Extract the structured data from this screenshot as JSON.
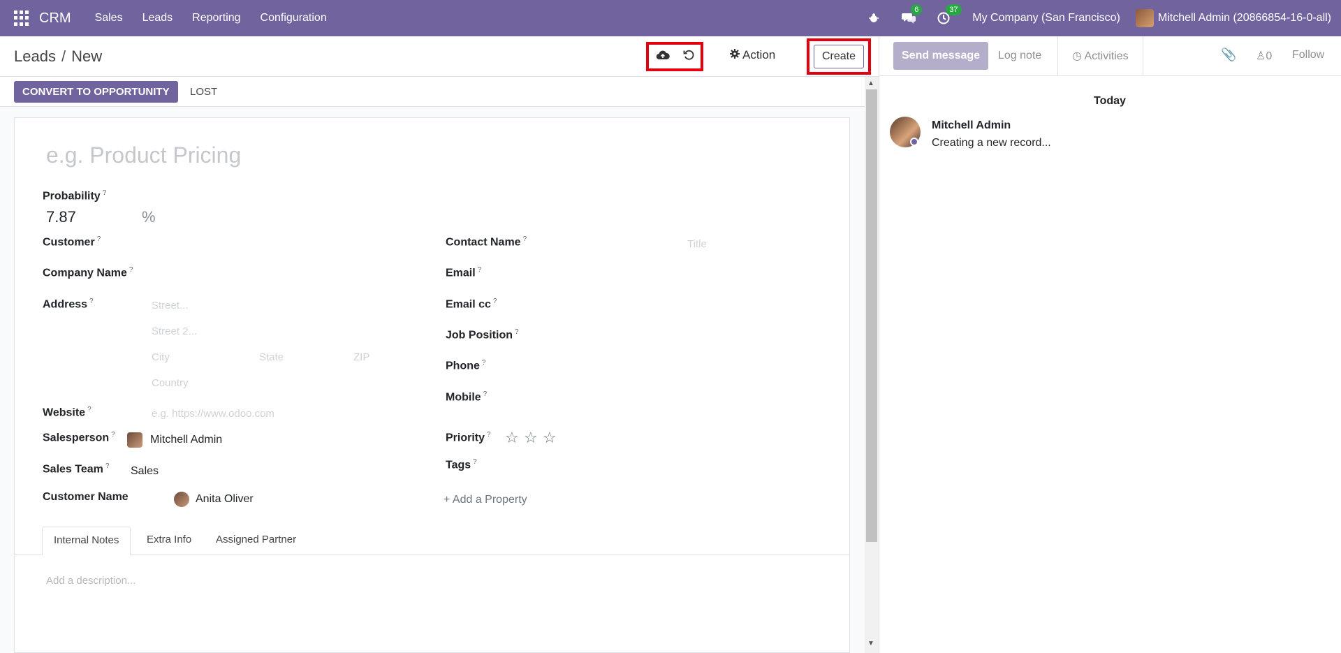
{
  "navbar": {
    "brand": "CRM",
    "menus": [
      "Sales",
      "Leads",
      "Reporting",
      "Configuration"
    ],
    "messages_count": "6",
    "activities_count": "37",
    "company": "My Company (San Francisco)",
    "user": "Mitchell Admin (20866854-16-0-all)"
  },
  "control": {
    "breadcrumb_parent": "Leads",
    "breadcrumb_sep": "/",
    "breadcrumb_current": "New",
    "action_label": "Action",
    "create_label": "Create"
  },
  "statusbar": {
    "convert_label": "CONVERT TO OPPORTUNITY",
    "lost_label": "LOST"
  },
  "form": {
    "title_placeholder": "e.g. Product Pricing",
    "probability_label": "Probability",
    "probability_value": "7.87",
    "probability_unit": "%",
    "customer_label": "Customer",
    "company_name_label": "Company Name",
    "address_label": "Address",
    "street_placeholder": "Street...",
    "street2_placeholder": "Street 2...",
    "city_placeholder": "City",
    "state_placeholder": "State",
    "zip_placeholder": "ZIP",
    "country_placeholder": "Country",
    "website_label": "Website",
    "website_placeholder": "e.g. https://www.odoo.com",
    "salesperson_label": "Salesperson",
    "salesperson_value": "Mitchell Admin",
    "sales_team_label": "Sales Team",
    "sales_team_value": "Sales",
    "customer_name_label": "Customer Name",
    "customer_name_value": "Anita Oliver",
    "contact_name_label": "Contact Name",
    "title_field_placeholder": "Title",
    "email_label": "Email",
    "email_cc_label": "Email cc",
    "job_position_label": "Job Position",
    "phone_label": "Phone",
    "mobile_label": "Mobile",
    "priority_label": "Priority",
    "priority_stars": 0,
    "priority_max": 3,
    "tags_label": "Tags",
    "add_property_label": "Add a Property",
    "help_mark": "?"
  },
  "tabs": [
    "Internal Notes",
    "Extra Info",
    "Assigned Partner"
  ],
  "notes_placeholder": "Add a description...",
  "chatter": {
    "send_message": "Send message",
    "log_note": "Log note",
    "activities": "Activities",
    "followers_count": "0",
    "follow": "Follow",
    "date_separator": "Today",
    "message_author": "Mitchell Admin",
    "message_body": "Creating a new record..."
  },
  "colors": {
    "brand": "#71639e",
    "highlight": "#e3000f",
    "badge": "#28a745"
  }
}
